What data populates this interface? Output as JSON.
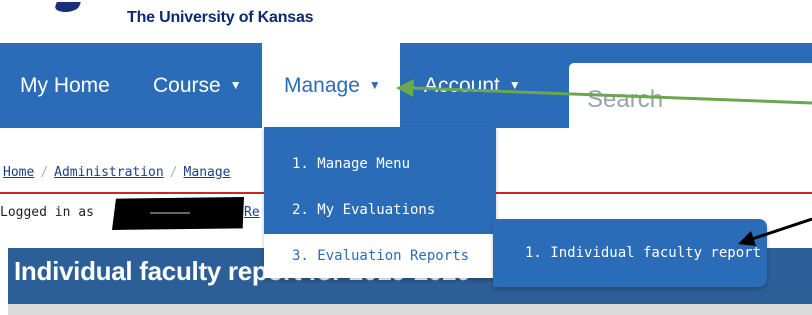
{
  "header": {
    "university_name": "The University of Kansas",
    "logo_icon": "ku-jayhawk-logo-icon"
  },
  "nav": {
    "home": "My Home",
    "course": "Course",
    "manage": "Manage",
    "account": "Account",
    "caret": "▼",
    "search_placeholder": "Search"
  },
  "breadcrumb": {
    "items": [
      "Home",
      "Administration",
      "Manage"
    ],
    "separator": "/"
  },
  "login": {
    "prefix": "Logged in as",
    "link_fragment": "Re"
  },
  "page": {
    "title": "Individual faculty report for 2019-2020"
  },
  "manage_menu": {
    "items": [
      "1. Manage Menu",
      "2. My Evaluations",
      "3. Evaluation Reports"
    ],
    "active_index": 2
  },
  "submenu": {
    "items": [
      "1. Individual faculty report"
    ]
  },
  "colors": {
    "nav_blue": "#2b6cb8",
    "title_bar": "#2c5f98",
    "ku_navy": "#0b2a73",
    "annotation_green": "#6aa84f",
    "annotation_black": "#000000",
    "rule_red": "#c8262b"
  }
}
